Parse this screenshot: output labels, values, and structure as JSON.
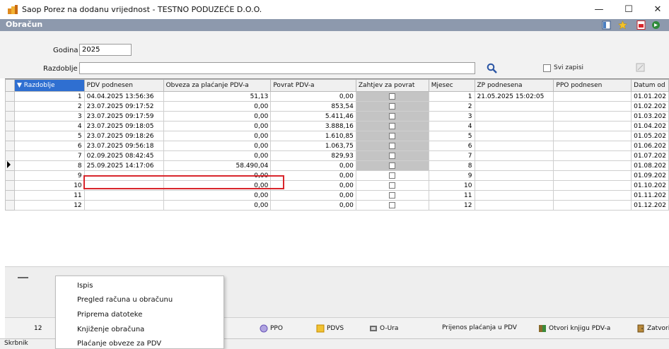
{
  "window": {
    "title": "Saop Porez na dodanu vrijednost - TESTNO PODUZEĆE D.O.O.",
    "minimize": "—",
    "maximize": "☐",
    "close": "✕"
  },
  "header": {
    "title": "Obračun"
  },
  "form": {
    "godina_label": "Godina",
    "godina_value": "2025",
    "razdoblje_label": "Razdoblje",
    "razdoblje_value": "",
    "svi_zapisi_label": "Svi zapisi"
  },
  "grid": {
    "columns": [
      "Razdoblje",
      "PDV podnesen",
      "Obveza za plaćanje PDV-a",
      "Povrat PDV-a",
      "Zahtjev za povrat",
      "Mjesec",
      "ZP podnesena",
      "PPO podnesen",
      "Datum od"
    ],
    "rows": [
      {
        "razdoblje": "1",
        "pdv": "04.04.2025 13:56:36",
        "obveza": "51,13",
        "povrat": "0,00",
        "mjesec": "1",
        "zp": "21.05.2025 15:02:05",
        "ppo": "",
        "datum": "01.01.202",
        "zah_filled": true
      },
      {
        "razdoblje": "2",
        "pdv": "23.07.2025 09:17:52",
        "obveza": "0,00",
        "povrat": "853,54",
        "mjesec": "2",
        "zp": "",
        "ppo": "",
        "datum": "01.02.202",
        "zah_filled": true
      },
      {
        "razdoblje": "3",
        "pdv": "23.07.2025 09:17:59",
        "obveza": "0,00",
        "povrat": "5.411,46",
        "mjesec": "3",
        "zp": "",
        "ppo": "",
        "datum": "01.03.202",
        "zah_filled": true
      },
      {
        "razdoblje": "4",
        "pdv": "23.07.2025 09:18:05",
        "obveza": "0,00",
        "povrat": "3.888,16",
        "mjesec": "4",
        "zp": "",
        "ppo": "",
        "datum": "01.04.202",
        "zah_filled": true
      },
      {
        "razdoblje": "5",
        "pdv": "23.07.2025 09:18:26",
        "obveza": "0,00",
        "povrat": "1.610,85",
        "mjesec": "5",
        "zp": "",
        "ppo": "",
        "datum": "01.05.202",
        "zah_filled": true
      },
      {
        "razdoblje": "6",
        "pdv": "23.07.2025 09:56:18",
        "obveza": "0,00",
        "povrat": "1.063,75",
        "mjesec": "6",
        "zp": "",
        "ppo": "",
        "datum": "01.06.202",
        "zah_filled": true
      },
      {
        "razdoblje": "7",
        "pdv": "02.09.2025 08:42:45",
        "obveza": "0,00",
        "povrat": "829,93",
        "mjesec": "7",
        "zp": "",
        "ppo": "",
        "datum": "01.07.202",
        "zah_filled": true
      },
      {
        "razdoblje": "8",
        "pdv": "25.09.2025 14:17:06",
        "obveza": "58.490,04",
        "povrat": "0,00",
        "mjesec": "8",
        "zp": "",
        "ppo": "",
        "datum": "01.08.202",
        "zah_filled": true,
        "current": true
      },
      {
        "razdoblje": "9",
        "pdv": "",
        "obveza": "0,00",
        "povrat": "0,00",
        "mjesec": "9",
        "zp": "",
        "ppo": "",
        "datum": "01.09.202",
        "zah_filled": false
      },
      {
        "razdoblje": "10",
        "pdv": "",
        "obveza": "0,00",
        "povrat": "0,00",
        "mjesec": "10",
        "zp": "",
        "ppo": "",
        "datum": "01.10.202",
        "zah_filled": false
      },
      {
        "razdoblje": "11",
        "pdv": "",
        "obveza": "0,00",
        "povrat": "0,00",
        "mjesec": "11",
        "zp": "",
        "ppo": "",
        "datum": "01.11.202",
        "zah_filled": false
      },
      {
        "razdoblje": "12",
        "pdv": "",
        "obveza": "0,00",
        "povrat": "0,00",
        "mjesec": "12",
        "zp": "",
        "ppo": "",
        "datum": "01.12.202",
        "zah_filled": false
      }
    ]
  },
  "context_menu": {
    "items": [
      "Ispis",
      "Pregled računa u obračunu",
      "Priprema datoteke",
      "Knjiženje obračuna",
      "Plaćanje obveze za PDV"
    ]
  },
  "toolbar": {
    "page": "12",
    "ppo": "PPO",
    "pdvs": "PDVS",
    "oura": "O-Ura",
    "prijenos": "Prijenos plaćanja u PDV",
    "otvori": "Otvori knjigu PDV-a",
    "zatvori": "Zatvori"
  },
  "status": {
    "text": "Skrbnik"
  },
  "colors": {
    "header_strip": "#8d99ad",
    "highlight": "#d9262c",
    "sort_header": "#2f6fd1"
  }
}
